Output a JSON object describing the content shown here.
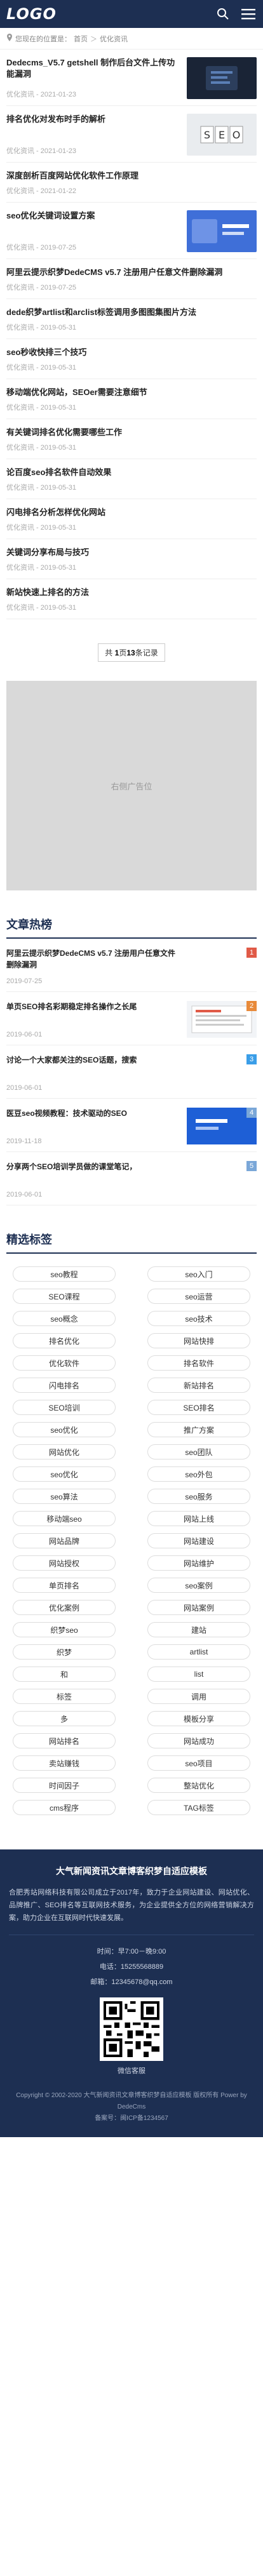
{
  "header": {
    "logo": "LOGO",
    "search_icon": "search-icon",
    "menu_icon": "menu-icon"
  },
  "breadcrumb": {
    "label": "您现在的位置是：",
    "home": "首页",
    "sep": "＞",
    "current": "优化资讯"
  },
  "articles": [
    {
      "title": "Dedecms_V5.7 getshell 制作后台文件上传功能漏洞",
      "meta": "优化资讯 - 2021-01-23",
      "thumb": "dark-blue"
    },
    {
      "title": "排名优化对发布时手的解析",
      "meta": "优化资讯 - 2021-01-23",
      "thumb": "seo-blocks"
    },
    {
      "title": "深度剖析百度网站优化软件工作原理",
      "meta": "优化资讯 - 2021-01-22",
      "thumb": "none"
    },
    {
      "title": "seo优化关键词设置方案",
      "meta": "优化资讯 - 2019-07-25",
      "thumb": "blue-banner"
    },
    {
      "title": "阿里云提示织梦DedeCMS v5.7 注册用户任意文件删除漏洞",
      "meta": "优化资讯 - 2019-07-25",
      "thumb": "none"
    },
    {
      "title": "dede织梦artlist和arclist标签调用多图图集图片方法",
      "meta": "优化资讯 - 2019-05-31",
      "thumb": "none"
    },
    {
      "title": "seo秒收快排三个技巧",
      "meta": "优化资讯 - 2019-05-31",
      "thumb": "none"
    },
    {
      "title": "移动端优化网站，SEOer需要注意细节",
      "meta": "优化资讯 - 2019-05-31",
      "thumb": "none"
    },
    {
      "title": "有关键词排名优化需要哪些工作",
      "meta": "优化资讯 - 2019-05-31",
      "thumb": "none"
    },
    {
      "title": "论百度seo排名软件自动效果",
      "meta": "优化资讯 - 2019-05-31",
      "thumb": "none"
    },
    {
      "title": "闪电排名分析怎样优化网站",
      "meta": "优化资讯 - 2019-05-31",
      "thumb": "none"
    },
    {
      "title": "关键词分享布局与技巧",
      "meta": "优化资讯 - 2019-05-31",
      "thumb": "none"
    },
    {
      "title": "新站快速上排名的方法",
      "meta": "优化资讯 - 2019-05-31",
      "thumb": "none"
    }
  ],
  "pager": {
    "prefix": "共 ",
    "pages": "1",
    "mid": "页",
    "count": "13",
    "suffix": "条记录"
  },
  "ad": {
    "label": "右侧广告位"
  },
  "hot": {
    "title": "文章热榜",
    "items": [
      {
        "title": "阿里云提示织梦DedeCMS v5.7 注册用户任意文件删除漏洞",
        "date": "2019-07-25",
        "rank": "1",
        "rank_color": "#e05a47",
        "thumb": "none"
      },
      {
        "title": "单页SEO排名彩期稳定排名操作之长尾",
        "date": "2019-06-01",
        "rank": "2",
        "rank_color": "#e88a3a",
        "thumb": "screen"
      },
      {
        "title": "讨论一个大家都关注的SEO话题，搜索",
        "date": "2019-06-01",
        "rank": "3",
        "rank_color": "#3a9ee8",
        "thumb": "none"
      },
      {
        "title": "医豆seo视频教程：技术驱动的SEO",
        "date": "2019-11-18",
        "rank": "4",
        "rank_color": "#7aa7d8",
        "thumb": "blue"
      },
      {
        "title": "分享两个SEO培训学员做的课堂笔记，",
        "date": "2019-06-01",
        "rank": "5",
        "rank_color": "#7aa7d8",
        "thumb": "none"
      }
    ]
  },
  "tags_section": {
    "title": "精选标签",
    "tags": [
      "seo教程",
      "seo入门",
      "SEO课程",
      "seo运营",
      "seo概念",
      "seo技术",
      "排名优化",
      "网站快排",
      "优化软件",
      "排名软件",
      "闪电排名",
      "新站排名",
      "SEO培训",
      "SEO排名",
      "seo优化",
      "推广方案",
      "网站优化",
      "seo团队",
      "seo优化",
      "seo外包",
      "seo算法",
      "seo服务",
      "移动端seo",
      "网站上线",
      "网站品牌",
      "网站建设",
      "网站授权",
      "网站维护",
      "单页排名",
      "seo案例",
      "优化案例",
      "网站案例",
      "织梦seo",
      "建站",
      "织梦",
      "artlist",
      "和",
      "list",
      "标签",
      "调用",
      "多",
      "模板分享",
      "网站排名",
      "网站成功",
      "卖站赚钱",
      "seo项目",
      "时间因子",
      "整站优化",
      "cms程序",
      "TAG标签"
    ]
  },
  "footer": {
    "title": "大气新闻资讯文章博客织梦自适应模板",
    "desc": "合肥秀站网络科技有限公司成立于2017年，致力于企业网站建设、网站优化、品牌推广、SEO排名等互联网技术服务，为企业提供全方位的网络营销解决方案，助力企业在互联网时代快速发展。",
    "time": "时间：早7:00－晚9:00",
    "phone": "电话：15255568889",
    "email": "邮箱：12345678@qq.com",
    "qr_caption": "微信客服",
    "copyright": "Copyright © 2002-2020 大气新闻资讯文章博客织梦自适应模板 版权所有 Power by DedeCms",
    "icp": "备案号：闽ICP备1234567"
  }
}
